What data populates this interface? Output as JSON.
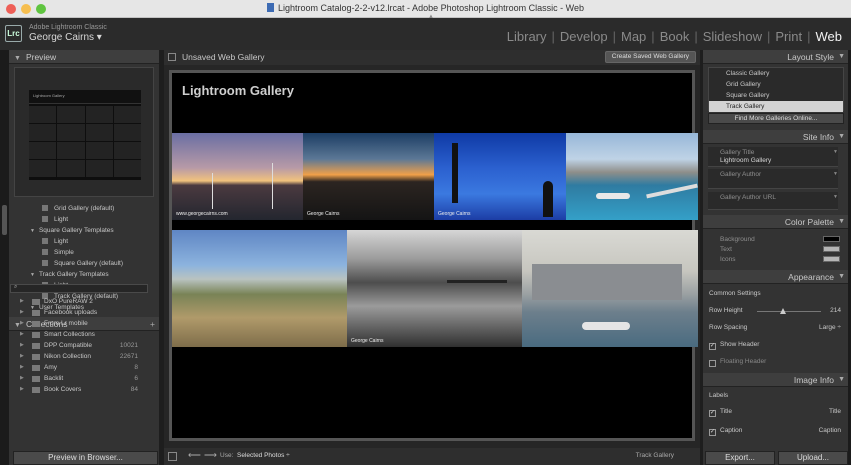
{
  "window": {
    "title": "Lightroom Catalog-2-2-v12.lrcat - Adobe Photoshop Lightroom Classic - Web"
  },
  "identity": {
    "logo": "Lrc",
    "app_name": "Adobe Lightroom Classic",
    "user": "George Cairns ▾"
  },
  "modules": [
    "Library",
    "Develop",
    "Map",
    "Book",
    "Slideshow",
    "Print",
    "Web"
  ],
  "active_module": "Web",
  "left_panel": {
    "preview_header": "Preview",
    "preview_thumb_title": "Lightroom Gallery",
    "templates": [
      {
        "label": "Grid Gallery (default)",
        "indent": 2,
        "type": "item"
      },
      {
        "label": "Light",
        "indent": 2,
        "type": "item"
      },
      {
        "label": "Square Gallery Templates",
        "indent": 1,
        "type": "folder"
      },
      {
        "label": "Light",
        "indent": 2,
        "type": "item"
      },
      {
        "label": "Simple",
        "indent": 2,
        "type": "item"
      },
      {
        "label": "Square Gallery (default)",
        "indent": 2,
        "type": "item"
      },
      {
        "label": "Track Gallery Templates",
        "indent": 1,
        "type": "folder"
      },
      {
        "label": "Light",
        "indent": 2,
        "type": "item"
      },
      {
        "label": "Track Gallery (default)",
        "indent": 2,
        "type": "item"
      },
      {
        "label": "User Templates",
        "indent": 1,
        "type": "folder"
      }
    ],
    "collections_header": "Collections",
    "collections": [
      {
        "label": "DxO PureRAW 2",
        "count": ""
      },
      {
        "label": "Facebook uploads",
        "count": ""
      },
      {
        "label": "From Lr mobile",
        "count": ""
      },
      {
        "label": "Smart Collections",
        "count": ""
      },
      {
        "label": "DPP Compatible",
        "count": "10021"
      },
      {
        "label": "Nikon Collection",
        "count": "22671"
      },
      {
        "label": "Amy",
        "count": "8"
      },
      {
        "label": "Backlit",
        "count": "6"
      },
      {
        "label": "Book Covers",
        "count": "84"
      }
    ],
    "preview_button": "Preview in Browser..."
  },
  "center": {
    "gallery_name": "Unsaved Web Gallery",
    "save_button": "Create Saved Web Gallery",
    "gallery_title": "Lightroom Gallery",
    "photos": [
      {
        "caption": "www.georgecairns.com"
      },
      {
        "caption": "George Cairns"
      },
      {
        "caption": "George Cairns"
      },
      {
        "caption": ""
      },
      {
        "caption": ""
      },
      {
        "caption": "George Cairns"
      },
      {
        "caption": ""
      }
    ],
    "use_label": "Use:",
    "use_value": "Selected Photos ÷",
    "template_name": "Track Gallery"
  },
  "right_panel": {
    "layout_style_header": "Layout Style",
    "styles": [
      "Classic Gallery",
      "Grid Gallery",
      "Square Gallery",
      "Track Gallery"
    ],
    "selected_style": "Track Gallery",
    "find_more": "Find More Galleries Online...",
    "site_info_header": "Site Info",
    "gallery_title_label": "Gallery Title",
    "gallery_title_value": "Lightroom Gallery",
    "gallery_author_label": "Gallery Author",
    "gallery_author_url_label": "Gallery Author URL",
    "color_palette_header": "Color Palette",
    "palette": [
      {
        "label": "Background",
        "color": "#000000"
      },
      {
        "label": "Text",
        "color": "#b5b5b5"
      },
      {
        "label": "Icons",
        "color": "#b5b5b5"
      }
    ],
    "appearance_header": "Appearance",
    "common_settings": "Common Settings",
    "row_height_label": "Row Height",
    "row_height_value": "214",
    "row_height_fraction": 0.4,
    "row_spacing_label": "Row Spacing",
    "row_spacing_value": "Large ÷",
    "show_header": "Show Header",
    "floating_header": "Floating Header",
    "image_info_header": "Image Info",
    "labels": "Labels",
    "title_label": "Title",
    "title_value": "Title",
    "caption_label": "Caption",
    "caption_value": "Caption",
    "export_button": "Export...",
    "upload_button": "Upload..."
  }
}
